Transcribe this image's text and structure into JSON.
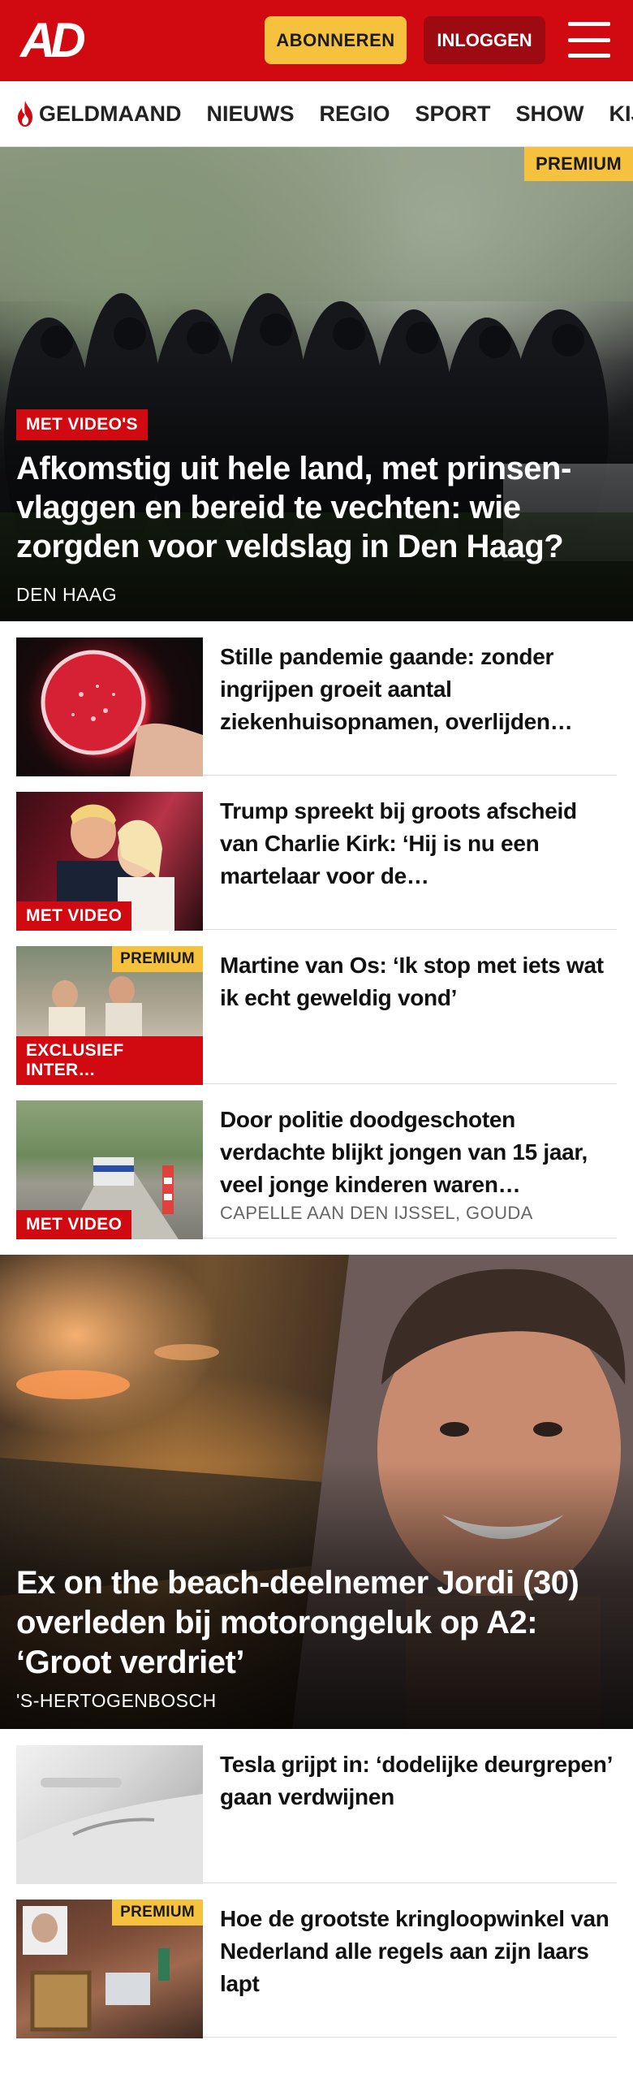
{
  "header": {
    "logo": "AD",
    "subscribe_label": "ABONNEREN",
    "login_label": "INLOGGEN",
    "brand_color": "#d10a11"
  },
  "nav": {
    "items": [
      "GELDMAAND",
      "NIEUWS",
      "REGIO",
      "SPORT",
      "SHOW",
      "KIJK"
    ],
    "first_icon": "flame-icon"
  },
  "hero": {
    "badge": "PREMIUM",
    "label": "MET VIDEO'S",
    "title": "Afkomstig uit hele land, met prinsen-vlaggen en bereid te vechten: wie zorgden voor veldslag in Den Haag?",
    "location": "DEN HAAG"
  },
  "articles": [
    {
      "title": "Stille pandemie gaande: zonder ingrijpen groeit aantal ziekenhuisopnamen, overlijden…"
    },
    {
      "label": "MET VIDEO",
      "title": "Trump spreekt bij groots afscheid van Charlie Kirk: ‘Hij is nu een martelaar voor de…"
    },
    {
      "badge": "PREMIUM",
      "label": "EXCLUSIEF INTER…",
      "title": "Martine van Os: ‘Ik stop met iets wat ik echt geweldig vond’"
    },
    {
      "label": "MET VIDEO",
      "title": "Door politie doodgeschoten verdachte blijkt jongen van 15 jaar, veel jonge kinderen waren…",
      "location": "CAPELLE AAN DEN IJSSEL, GOUDA"
    }
  ],
  "feature": {
    "title": "Ex on the beach-deelnemer Jordi (30) overleden bij motorongeluk op A2: ‘Groot verdriet’",
    "location": "'S-HERTOGENBOSCH"
  },
  "articles2": [
    {
      "title": "Tesla grijpt in: ‘dodelijke deurgrepen’ gaan verdwijnen"
    },
    {
      "badge": "PREMIUM",
      "title": "Hoe de grootste kringloopwinkel van Nederland alle regels aan zijn laars lapt"
    }
  ]
}
